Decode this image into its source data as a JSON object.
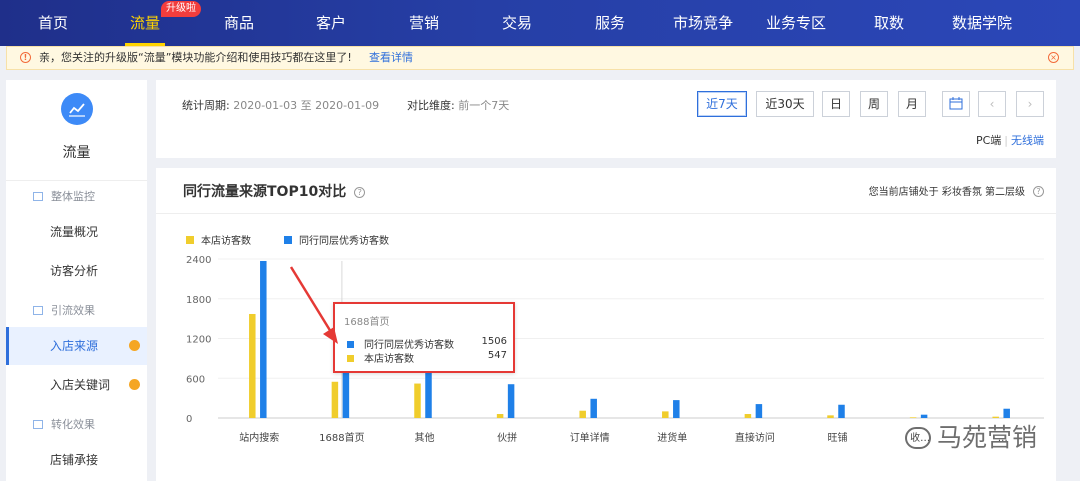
{
  "topnav": {
    "items": [
      "首页",
      "流量",
      "商品",
      "客户",
      "营销",
      "交易",
      "服务",
      "市场竞争",
      "业务专区",
      "取数",
      "数据学院"
    ],
    "active_index": 1,
    "badge": "升级啦"
  },
  "notice": {
    "text": "亲，您关注的升级版“流量”模块功能介绍和使用技巧都在这里了!",
    "link": "查看详情"
  },
  "sidebar": {
    "title": "流量",
    "groups": [
      {
        "label": "整体监控",
        "items": [
          "流量概况",
          "访客分析"
        ]
      },
      {
        "label": "引流效果",
        "items": [
          "入店来源",
          "入店关键词"
        ]
      },
      {
        "label": "转化效果",
        "items": [
          "店铺承接"
        ]
      }
    ],
    "active_item": "入店来源"
  },
  "filter": {
    "period_label": "统计周期:",
    "period_value": "2020-01-03 至 2020-01-09",
    "compare_label": "对比维度:",
    "compare_value": "前一个7天",
    "buttons": [
      "近7天",
      "近30天",
      "日",
      "周",
      "月"
    ],
    "active_button": "近7天",
    "platform_pc": "PC端",
    "platform_wireless": "无线端"
  },
  "chart_panel": {
    "title": "同行流量来源TOP10对比",
    "level_note": "您当前店铺处于 彩妆香氛 第二层级"
  },
  "tooltip": {
    "title": "1688首页",
    "rows": [
      {
        "name": "同行同层优秀访客数",
        "value": "1506"
      },
      {
        "name": "本店访客数",
        "value": "547"
      }
    ]
  },
  "watermark": "马苑营销",
  "colors": {
    "shop": "#f0cd2c",
    "peer": "#1f80e8",
    "accent": "#2f6fdb",
    "nav_active": "#ffd400"
  },
  "chart_data": {
    "type": "bar",
    "title": "同行流量来源TOP10对比",
    "categories": [
      "站内搜索",
      "1688首页",
      "其他",
      "伙拼",
      "订单详情",
      "进货单",
      "直接访问",
      "旺铺",
      "收…",
      "…"
    ],
    "series": [
      {
        "name": "本店访客数",
        "values": [
          1570,
          547,
          520,
          60,
          110,
          100,
          60,
          40,
          10,
          20
        ]
      },
      {
        "name": "同行同层优秀访客数",
        "values": [
          2370,
          1506,
          850,
          510,
          290,
          270,
          210,
          200,
          50,
          140
        ]
      }
    ],
    "ylim": [
      0,
      2400
    ],
    "yticks": [
      0,
      600,
      1200,
      1800,
      2400
    ],
    "legend": "top-left",
    "grid": true
  }
}
